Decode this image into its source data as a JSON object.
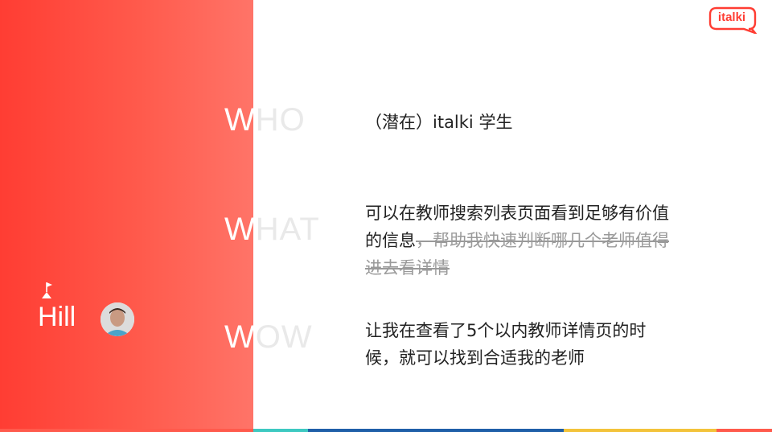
{
  "logo": {
    "text": "italki"
  },
  "presenter": {
    "name": "Hill"
  },
  "labels": {
    "who": {
      "first": "W",
      "rest": "HO"
    },
    "what": {
      "first": "W",
      "rest": "HAT"
    },
    "wow": {
      "first": "W",
      "rest": "OW"
    }
  },
  "answers": {
    "who": "（潜在）italki 学生",
    "what": {
      "line1": "可以在教师搜索列表页面看到足够有价值",
      "line2_plain": "的信息",
      "line2_struck": "，帮助我快速判断哪几个老师值得",
      "line3_struck": "进去看详情"
    },
    "wow": {
      "line1": "让我在查看了5个以内教师详情页的时",
      "line2": "候，就可以找到合适我的老师"
    }
  },
  "colors": {
    "accent": "#ff3d33",
    "bottom_bar": [
      "#ff5a4c",
      "#3ec9c1",
      "#1f5fa8",
      "#f3c33a",
      "#ff5a4c"
    ]
  }
}
